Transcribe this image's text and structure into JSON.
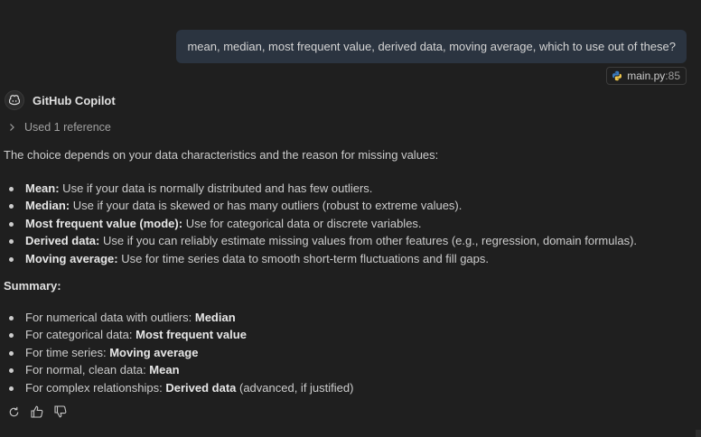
{
  "user_message": {
    "text": "mean, median, most frequent value, derived data, moving average, which to use out of these?"
  },
  "reference_chip": {
    "icon": "python-icon",
    "file": "main.py",
    "separator": ":",
    "line": "85"
  },
  "assistant": {
    "name": "GitHub Copilot",
    "icon": "copilot-icon",
    "used_references_label": "Used 1 reference",
    "intro": "The choice depends on your data characteristics and the reason for missing values:",
    "options": [
      {
        "term": "Mean:",
        "text": " Use if your data is normally distributed and has few outliers."
      },
      {
        "term": "Median:",
        "text": " Use if your data is skewed or has many outliers (robust to extreme values)."
      },
      {
        "term": "Most frequent value (mode):",
        "text": " Use for categorical data or discrete variables."
      },
      {
        "term": "Derived data:",
        "text": " Use if you can reliably estimate missing values from other features (e.g., regression, domain formulas)."
      },
      {
        "term": "Moving average:",
        "text": " Use for time series data to smooth short-term fluctuations and fill gaps."
      }
    ],
    "summary_title": "Summary:",
    "summary": [
      {
        "prefix": "For numerical data with outliers: ",
        "answer": "Median",
        "suffix": ""
      },
      {
        "prefix": "For categorical data: ",
        "answer": "Most frequent value",
        "suffix": ""
      },
      {
        "prefix": "For time series: ",
        "answer": "Moving average",
        "suffix": ""
      },
      {
        "prefix": "For normal, clean data: ",
        "answer": "Mean",
        "suffix": ""
      },
      {
        "prefix": "For complex relationships: ",
        "answer": "Derived data",
        "suffix": " (advanced, if justified)"
      }
    ]
  },
  "actions": [
    {
      "name": "retry-icon"
    },
    {
      "name": "thumbs-up-icon"
    },
    {
      "name": "thumbs-down-icon"
    }
  ],
  "colors": {
    "background": "#1f1f1f",
    "user_bubble": "#2b3440",
    "text": "#cccccc",
    "python_blue": "#3b7bbf",
    "python_yellow": "#f2c94c"
  }
}
